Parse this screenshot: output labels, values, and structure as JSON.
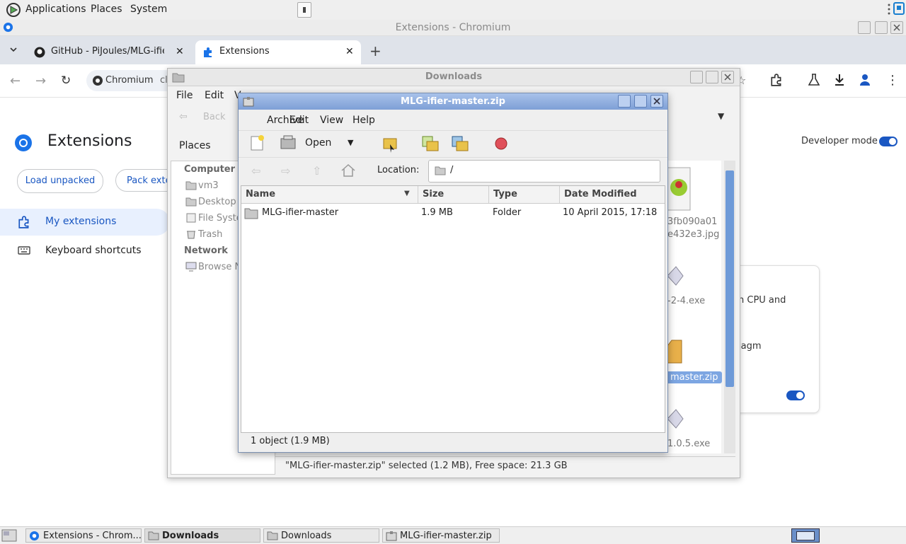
{
  "top_panel": {
    "applications": "Applications",
    "places": "Places",
    "system": "System"
  },
  "chromium": {
    "window_title": "Extensions - Chromium",
    "tabs": [
      {
        "label": "GitHub - PiJoules/MLG-ifier:"
      },
      {
        "label": "Extensions"
      }
    ],
    "omnibox_site": "Chromium",
    "omnibox_text": "cl",
    "page_title": "Extensions",
    "developer_mode_label": "Developer mode",
    "load_unpacked": "Load unpacked",
    "pack_extension": "Pack exte",
    "nav": {
      "my_extensions": "My extensions",
      "keyboard_shortcuts": "Keyboard shortcuts"
    },
    "card_text_1": "n CPU and",
    "card_text_2": "iagm"
  },
  "downloads": {
    "window_title": "Downloads",
    "menu": {
      "file": "File",
      "edit": "Edit",
      "view": "V"
    },
    "back": "Back",
    "places_label": "Places",
    "sidebar": {
      "computer": "Computer",
      "items": [
        "vm3",
        "Desktop",
        "File Syste",
        "Trash"
      ],
      "network": "Network",
      "network_items": [
        "Browse N"
      ]
    },
    "files": {
      "jpg_line1": "3fb090a01",
      "jpg_line2": "e432e3.jpg",
      "exe1": "-2-4.exe",
      "zip_selected": "master.zip",
      "exe2": "1.0.5.exe"
    },
    "status": "\"MLG-ifier-master.zip\" selected (1.2 MB), Free space: 21.3 GB"
  },
  "archive": {
    "window_title": "MLG-ifier-master.zip",
    "menu": {
      "archive": "Archive",
      "edit": "Edit",
      "view": "View",
      "help": "Help"
    },
    "open_label": "Open",
    "location_label": "Location:",
    "location_value": "/",
    "columns": {
      "name": "Name",
      "size": "Size",
      "type": "Type",
      "date": "Date Modified"
    },
    "rows": [
      {
        "name": "MLG-ifier-master",
        "size": "1.9 MB",
        "type": "Folder",
        "date": "10 April 2015, 17:18"
      }
    ],
    "status": "1 object (1.9 MB)"
  },
  "taskbar": {
    "items": [
      "Extensions - Chrom...",
      "Downloads",
      "Downloads",
      "MLG-ifier-master.zip"
    ]
  },
  "colors": {
    "accent": "#1a57c2",
    "title_active": "#7e9fd6",
    "selection": "#3d7bd6"
  }
}
